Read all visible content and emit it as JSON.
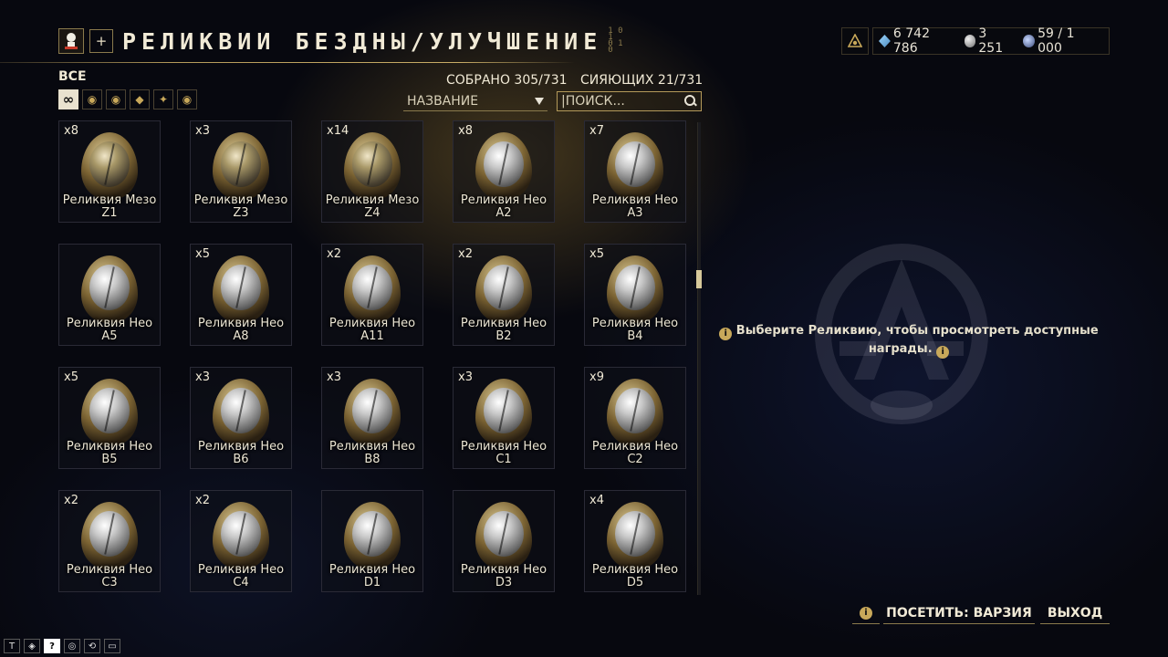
{
  "header": {
    "title": "РЕЛИКВИИ БЕЗДНЫ/УЛУЧШЕНИЕ",
    "plus_label": "+"
  },
  "currency": {
    "platinum": "6 742 786",
    "credits": "3 251",
    "endo": "59 / 1 000"
  },
  "filter": {
    "all_label": "ВСЕ",
    "collected": "СОБРАНО 305/731",
    "radiant": "СИЯЮЩИХ 21/731",
    "sort_label": "НАЗВАНИЕ",
    "search_placeholder": "|ПОИСК...",
    "tabs": [
      {
        "icon": "infinity-icon",
        "glyph": "∞"
      },
      {
        "icon": "lith-relic-icon",
        "glyph": "◉"
      },
      {
        "icon": "meso-relic-icon",
        "glyph": "◉"
      },
      {
        "icon": "neo-relic-icon",
        "glyph": "◆"
      },
      {
        "icon": "axi-relic-icon",
        "glyph": "✦"
      },
      {
        "icon": "requiem-relic-icon",
        "glyph": "◉"
      }
    ]
  },
  "relics": [
    {
      "count": "x8",
      "name": "Реликвия Мезо",
      "code": "Z1",
      "era": "meso"
    },
    {
      "count": "x3",
      "name": "Реликвия Мезо",
      "code": "Z3",
      "era": "meso"
    },
    {
      "count": "x14",
      "name": "Реликвия Мезо",
      "code": "Z4",
      "era": "meso"
    },
    {
      "count": "x8",
      "name": "Реликвия Нео",
      "code": "A2",
      "era": "neo"
    },
    {
      "count": "x7",
      "name": "Реликвия Нео",
      "code": "A3",
      "era": "neo"
    },
    {
      "count": "",
      "name": "Реликвия Нео",
      "code": "A5",
      "era": "neo"
    },
    {
      "count": "x5",
      "name": "Реликвия Нео",
      "code": "A8",
      "era": "neo"
    },
    {
      "count": "x2",
      "name": "Реликвия Нео",
      "code": "A11",
      "era": "neo"
    },
    {
      "count": "x2",
      "name": "Реликвия Нео",
      "code": "B2",
      "era": "neo"
    },
    {
      "count": "x5",
      "name": "Реликвия Нео",
      "code": "B4",
      "era": "neo"
    },
    {
      "count": "x5",
      "name": "Реликвия Нео",
      "code": "B5",
      "era": "neo"
    },
    {
      "count": "x3",
      "name": "Реликвия Нео",
      "code": "B6",
      "era": "neo"
    },
    {
      "count": "x3",
      "name": "Реликвия Нео",
      "code": "B8",
      "era": "neo"
    },
    {
      "count": "x3",
      "name": "Реликвия Нео",
      "code": "C1",
      "era": "neo"
    },
    {
      "count": "x9",
      "name": "Реликвия Нео",
      "code": "C2",
      "era": "neo"
    },
    {
      "count": "x2",
      "name": "Реликвия Нео",
      "code": "C3",
      "era": "neo"
    },
    {
      "count": "x2",
      "name": "Реликвия Нео",
      "code": "C4",
      "era": "neo"
    },
    {
      "count": "",
      "name": "Реликвия Нео",
      "code": "D1",
      "era": "neo"
    },
    {
      "count": "",
      "name": "Реликвия Нео",
      "code": "D3",
      "era": "neo"
    },
    {
      "count": "x4",
      "name": "Реликвия Нео",
      "code": "D5",
      "era": "neo"
    }
  ],
  "detail": {
    "hint_line1": "Выберите Реликвию, чтобы просмотреть доступные",
    "hint_line2": "награды."
  },
  "buttons": {
    "info": "i",
    "visit": "ПОСЕТИТЬ: ВАРЗИЯ",
    "exit": "ВЫХОД"
  },
  "tray": [
    "T",
    "◈",
    "?",
    "◎",
    "⟲",
    "▭"
  ]
}
